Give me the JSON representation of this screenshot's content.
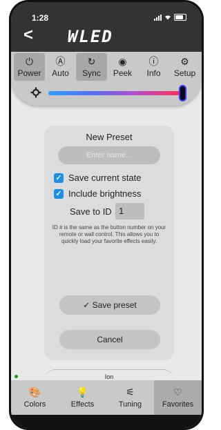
{
  "status": {
    "time": "1:28"
  },
  "header": {
    "back_label": "<",
    "logo_text": "WLED"
  },
  "tabs": [
    {
      "label": "Power",
      "icon": "⏻",
      "active": true
    },
    {
      "label": "Auto",
      "icon": "Ⓐ",
      "active": false
    },
    {
      "label": "Sync",
      "icon": "↻",
      "active": true
    },
    {
      "label": "Peek",
      "icon": "◉",
      "active": false
    },
    {
      "label": "Info",
      "icon": "ⓘ",
      "active": false
    },
    {
      "label": "Setup",
      "icon": "⚙",
      "active": false
    }
  ],
  "brightness": {
    "value_fraction": 1.0
  },
  "dialog": {
    "title": "New Preset",
    "name_placeholder": "Enter name...",
    "save_state_label": "Save current state",
    "include_brightness_label": "Include brightness",
    "save_to_id_label": "Save to ID",
    "save_to_id_value": "1",
    "help_text": "ID # is the same as the button number on your remote or wall control. This allows you to quickly load your favorite effects easily.",
    "save_button": "✓  Save preset",
    "cancel_button": "Cancel"
  },
  "ion": {
    "label": "Ion"
  },
  "bottom_nav": [
    {
      "label": "Colors",
      "icon": "🎨",
      "active": false
    },
    {
      "label": "Effects",
      "icon": "💡",
      "active": false
    },
    {
      "label": "Tuning",
      "icon": "⚟",
      "active": false
    },
    {
      "label": "Favorites",
      "icon": "♡",
      "active": true
    }
  ],
  "colors": {
    "accent": "#1a90e8",
    "header": "#333333",
    "nav": "#c9c9c9",
    "active_tab": "#a8a8a8"
  }
}
